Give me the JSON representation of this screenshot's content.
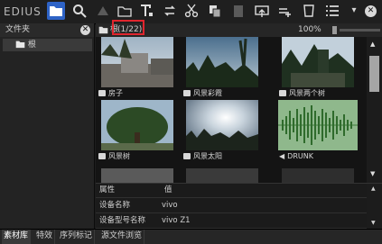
{
  "app": {
    "logo": "EDIUS"
  },
  "colors": {
    "accent": "#2e63c6",
    "highlight": "#e0252e",
    "waveform": "#58a858"
  },
  "folder_panel": {
    "title": "文件夹",
    "root_label": "根"
  },
  "bin": {
    "path_char": "根",
    "count": "(1/22)",
    "zoom": "100%",
    "items": [
      {
        "label": "房子",
        "icon": "image-icon"
      },
      {
        "label": "风景彩霞",
        "icon": "image-icon"
      },
      {
        "label": "风景两个树",
        "icon": "image-icon"
      },
      {
        "label": "风景树",
        "icon": "image-icon"
      },
      {
        "label": "风景太阳",
        "icon": "image-icon"
      },
      {
        "label": "DRUNK",
        "icon": "speaker-icon"
      }
    ]
  },
  "properties": {
    "header": {
      "attr": "属性",
      "value": "值"
    },
    "rows": [
      {
        "attr": "设备名称",
        "value": "vivo"
      },
      {
        "attr": "设备型号名称",
        "value": "vivo Z1"
      }
    ]
  },
  "tabs": [
    "素材库",
    "特效",
    "序列标记",
    "源文件浏览"
  ]
}
